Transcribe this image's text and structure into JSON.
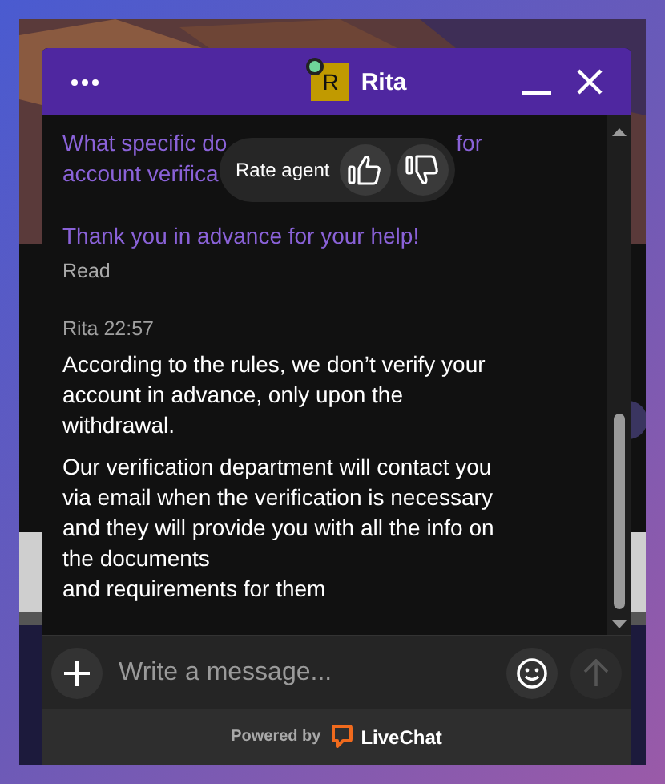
{
  "header": {
    "agent_name": "Rita",
    "avatar_letter": "R",
    "online": true
  },
  "messages": [
    {
      "kind": "visitor_partial",
      "lines": [
        [
          "What specific do",
          "for"
        ],
        [
          "account verifica"
        ]
      ]
    },
    {
      "kind": "visitor",
      "paragraphs": [
        "Thank you in advance for your help!"
      ],
      "status": "Read"
    },
    {
      "kind": "agent",
      "author": "Rita",
      "time": "22:57",
      "paragraphs": [
        "According to the rules, we don’t verify your account in advance, only upon the withdrawal.",
        "Our verification department will contact you via email when the verification is necessary and they will provide you with all the info on the documents\nand requirements for them"
      ]
    }
  ],
  "rate_popup": {
    "label": "Rate agent"
  },
  "composer": {
    "placeholder": "Write a message...",
    "send_disabled": true
  },
  "footer": {
    "prefix": "Powered by",
    "brand": "LiveChat"
  }
}
